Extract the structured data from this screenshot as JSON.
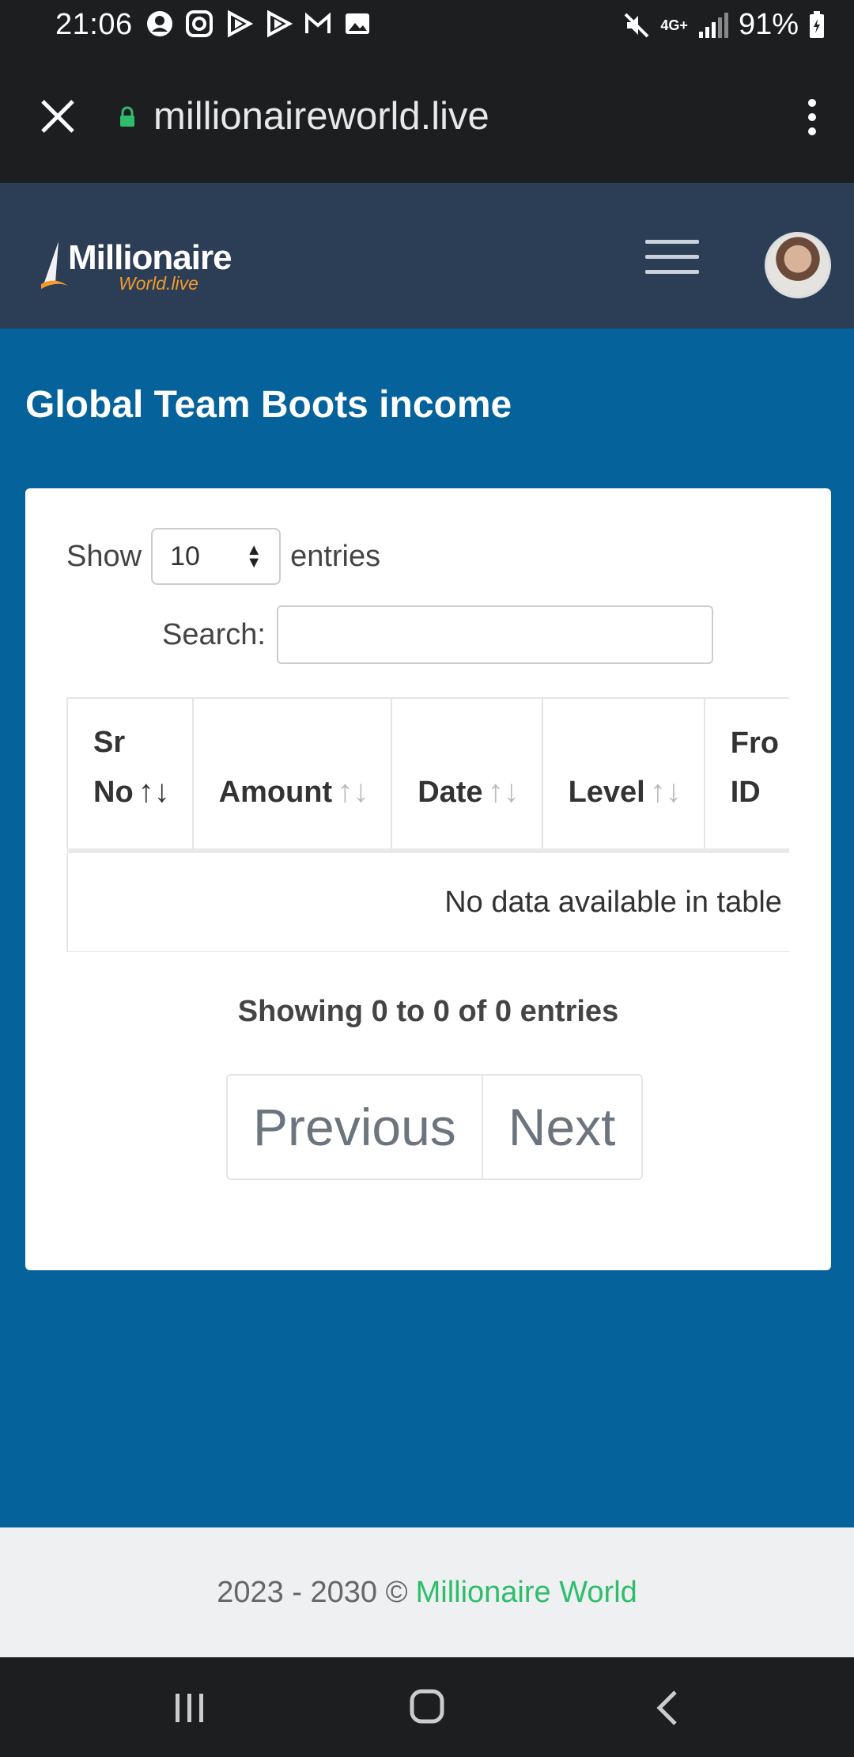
{
  "status_bar": {
    "time": "21:06",
    "network": "4G+",
    "battery": "91%",
    "notification_icons": [
      "person-icon",
      "instagram-icon",
      "play-icon",
      "play-icon",
      "gmail-icon",
      "image-icon"
    ]
  },
  "browser": {
    "url": "millionaireworld.live"
  },
  "header": {
    "logo_line1": "Millionaire",
    "logo_line2": "World.live"
  },
  "page": {
    "title": "Global Team Boots income"
  },
  "table_controls": {
    "show_label": "Show",
    "entries_value": "10",
    "entries_label": "entries",
    "search_label": "Search:",
    "search_value": ""
  },
  "table": {
    "columns": [
      {
        "line1": "Sr",
        "line2": "No"
      },
      {
        "line1": "",
        "line2": "Amount"
      },
      {
        "line1": "",
        "line2": "Date"
      },
      {
        "line1": "",
        "line2": "Level"
      },
      {
        "line1": "Fro",
        "line2": "ID"
      }
    ],
    "empty_message": "No data available in table"
  },
  "pagination": {
    "info": "Showing 0 to 0 of 0 entries",
    "previous": "Previous",
    "next": "Next"
  },
  "footer": {
    "years": "2023 - 2030 ©",
    "link": "Millionaire World"
  },
  "colors": {
    "page_bg": "#05629a",
    "header_bg": "#2c3e55",
    "footer_link": "#2ebd6b",
    "logo_accent": "#f39a2b"
  }
}
